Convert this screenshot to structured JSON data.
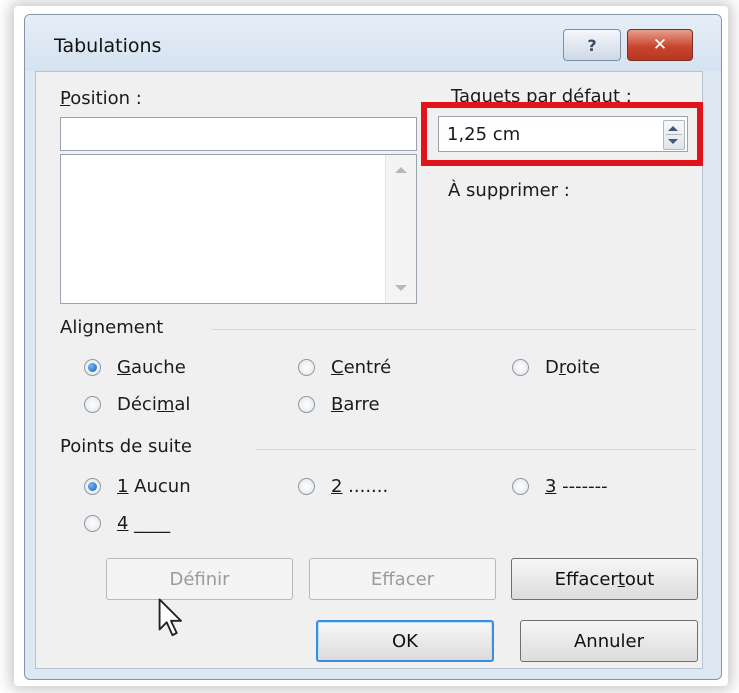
{
  "dialog": {
    "title": "Tabulations",
    "help_glyph": "?",
    "close_glyph": "✕"
  },
  "position": {
    "label_prefix": "P",
    "label_rest": "osition :",
    "value": "",
    "list_items": []
  },
  "default_tabs": {
    "label": "Taquets par défaut :",
    "value": "1,25 cm"
  },
  "to_delete": {
    "label": "À supprimer :"
  },
  "alignment": {
    "heading": "Alignement",
    "options": [
      {
        "pre": "",
        "key": "G",
        "post": "auche",
        "checked": true
      },
      {
        "pre": "",
        "key": "C",
        "post": "entré",
        "checked": false
      },
      {
        "pre": "D",
        "key": "r",
        "post": "oite",
        "checked": false
      },
      {
        "pre": "Déci",
        "key": "m",
        "post": "al",
        "checked": false
      },
      {
        "pre": "",
        "key": "B",
        "post": "arre",
        "checked": false
      }
    ]
  },
  "leaders": {
    "heading": "Points de suite",
    "options": [
      {
        "pre": "",
        "key": "1",
        "post": " Aucun",
        "checked": true
      },
      {
        "pre": "",
        "key": "2",
        "post": " .......",
        "checked": false
      },
      {
        "pre": "",
        "key": "3",
        "post": " -------",
        "checked": false
      },
      {
        "pre": "",
        "key": "4",
        "post": " ____",
        "checked": false
      }
    ]
  },
  "buttons": {
    "define": "Définir",
    "clear": "Effacer",
    "clear_all_pre": "Effacer ",
    "clear_all_key": "t",
    "clear_all_post": "out",
    "ok": "OK",
    "cancel": "Annuler"
  },
  "colors": {
    "highlight_box": "#e2141b",
    "radio_selected": "#1d5ea8",
    "default_button_border": "#3b8de0"
  }
}
